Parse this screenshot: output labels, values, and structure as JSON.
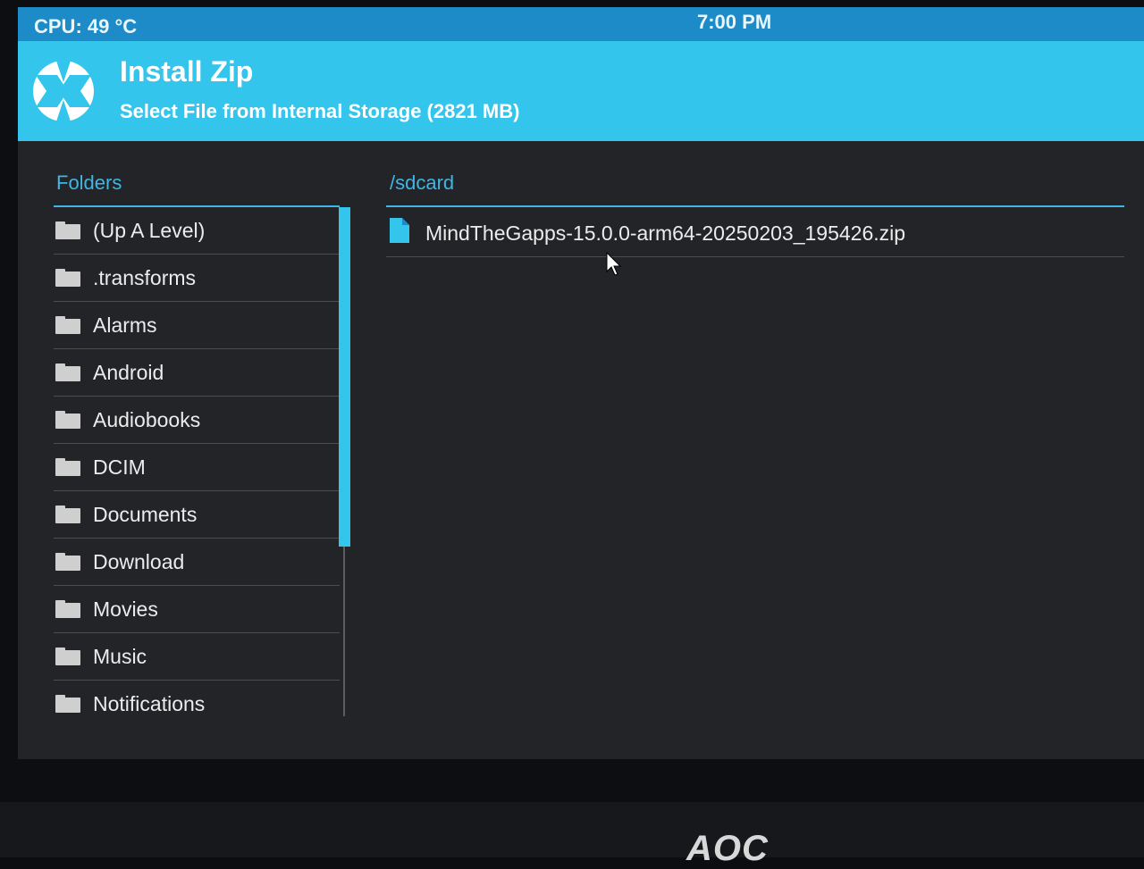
{
  "status_bar": {
    "cpu_temp": "CPU: 49 °C",
    "clock": "7:00 PM"
  },
  "header": {
    "title": "Install Zip",
    "subtitle": "Select File from Internal Storage (2821 MB)",
    "logo_icon": "twrp-logo-icon"
  },
  "folders": {
    "heading": "Folders",
    "items": [
      {
        "label": "(Up A Level)"
      },
      {
        "label": ".transforms"
      },
      {
        "label": "Alarms"
      },
      {
        "label": "Android"
      },
      {
        "label": "Audiobooks"
      },
      {
        "label": "DCIM"
      },
      {
        "label": "Documents"
      },
      {
        "label": "Download"
      },
      {
        "label": "Movies"
      },
      {
        "label": "Music"
      },
      {
        "label": "Notifications"
      }
    ]
  },
  "files": {
    "path": "/sdcard",
    "items": [
      {
        "label": "MindTheGapps-15.0.0-arm64-20250203_195426.zip"
      }
    ]
  },
  "nav": {
    "back_icon": "back-icon",
    "home_icon": "home-icon",
    "menu_icon": "menu-icon"
  },
  "monitor": {
    "brand": "AOC"
  },
  "colors": {
    "accent": "#33c5ec",
    "status_bar": "#1d8bc7",
    "background": "#222428",
    "text": "#ececec"
  }
}
